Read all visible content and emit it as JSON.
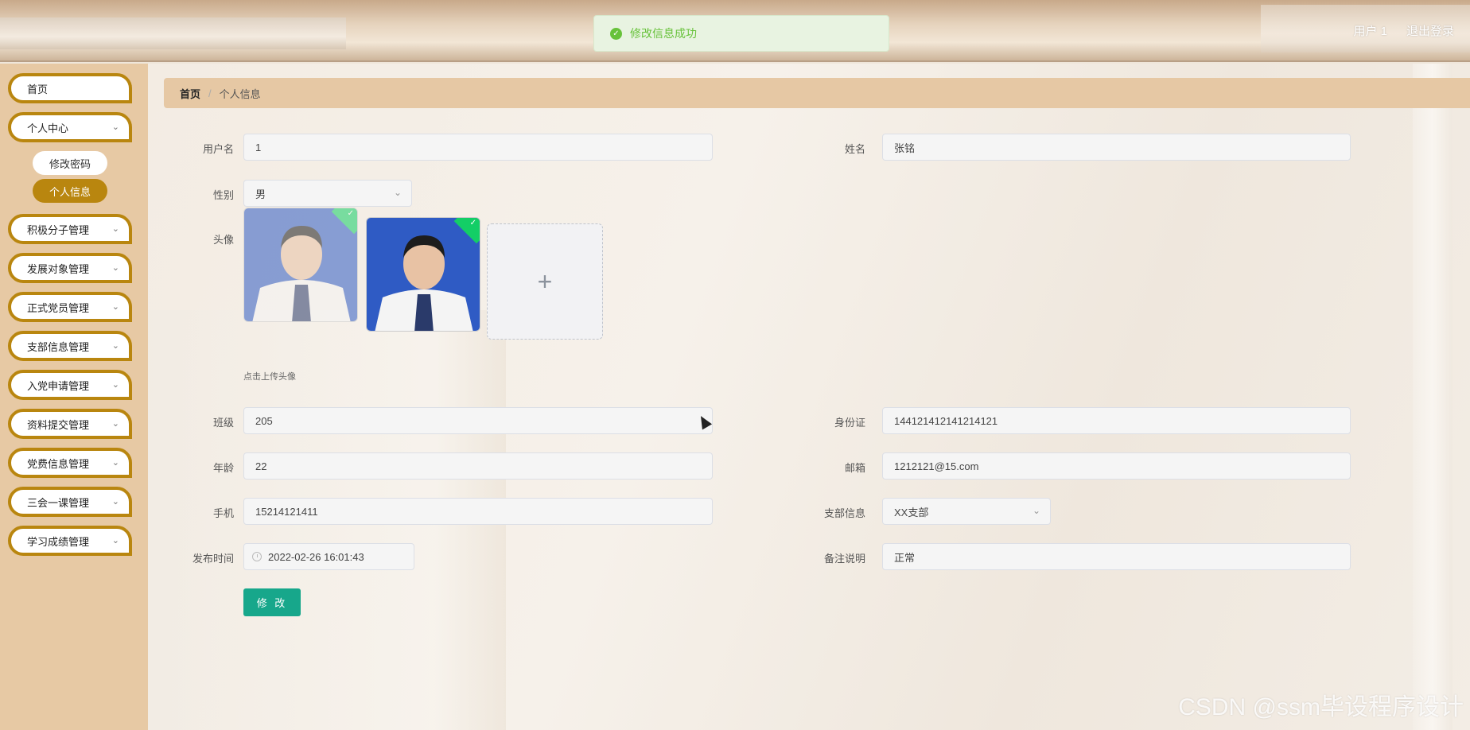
{
  "header": {
    "user_label": "用户 1",
    "logout_label": "退出登录"
  },
  "toast": {
    "message": "修改信息成功"
  },
  "sidebar": {
    "items": [
      {
        "label": "首页"
      },
      {
        "label": "个人中心"
      },
      {
        "label": "积极分子管理"
      },
      {
        "label": "发展对象管理"
      },
      {
        "label": "正式党员管理"
      },
      {
        "label": "支部信息管理"
      },
      {
        "label": "入党申请管理"
      },
      {
        "label": "资料提交管理"
      },
      {
        "label": "党费信息管理"
      },
      {
        "label": "三会一课管理"
      },
      {
        "label": "学习成绩管理"
      }
    ],
    "sub_items": [
      {
        "label": "修改密码"
      },
      {
        "label": "个人信息"
      }
    ]
  },
  "breadcrumb": {
    "home": "首页",
    "separator": "/",
    "current": "个人信息"
  },
  "form": {
    "username": {
      "label": "用户名",
      "value": "1"
    },
    "name": {
      "label": "姓名",
      "value": "张铭"
    },
    "gender": {
      "label": "性别",
      "value": "男"
    },
    "avatar": {
      "label": "头像",
      "hint": "点击上传头像",
      "add_symbol": "+"
    },
    "class": {
      "label": "班级",
      "value": "205"
    },
    "id_card": {
      "label": "身份证",
      "value": "144121412141214121"
    },
    "age": {
      "label": "年龄",
      "value": "22"
    },
    "email": {
      "label": "邮箱",
      "value": "1212121@15.com"
    },
    "phone": {
      "label": "手机",
      "value": "15214121411"
    },
    "branch": {
      "label": "支部信息",
      "value": "XX支部"
    },
    "publish_time": {
      "label": "发布时间",
      "value": "2022-02-26 16:01:43"
    },
    "remark": {
      "label": "备注说明",
      "value": "正常"
    },
    "submit_label": "修 改"
  },
  "watermark": "CSDN @ssm毕设程序设计",
  "colors": {
    "accent_gold": "#b9860f",
    "submit_green": "#17a78b",
    "success_green": "#67c23a"
  }
}
